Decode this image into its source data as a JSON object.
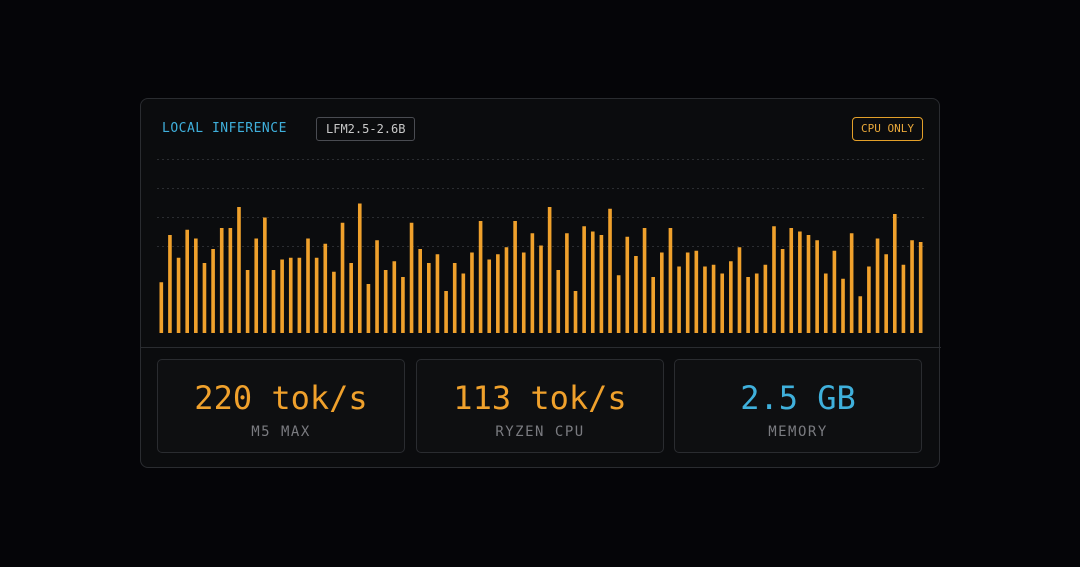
{
  "header": {
    "title": "LOCAL INFERENCE",
    "model": "LFM2.5-2.6B",
    "badge": "CPU ONLY"
  },
  "colors": {
    "bar": "#f0a12c",
    "accent_blue": "#3fb0dc",
    "accent_orange": "#e9a83a"
  },
  "chart_data": {
    "type": "bar",
    "ylim": [
      0,
      100
    ],
    "grid": true,
    "values": [
      29,
      56,
      43,
      59,
      54,
      40,
      48,
      60,
      60,
      72,
      36,
      54,
      66,
      36,
      42,
      43,
      43,
      54,
      43,
      51,
      35,
      63,
      40,
      74,
      28,
      53,
      36,
      41,
      32,
      63,
      48,
      40,
      45,
      24,
      40,
      34,
      46,
      64,
      42,
      45,
      49,
      64,
      46,
      57,
      50,
      72,
      36,
      57,
      24,
      61,
      58,
      56,
      71,
      33,
      55,
      44,
      60,
      32,
      46,
      60,
      38,
      46,
      47,
      38,
      39,
      34,
      41,
      49,
      32,
      34,
      39,
      61,
      48,
      60,
      58,
      56,
      53,
      34,
      47,
      31,
      57,
      21,
      38,
      54,
      45,
      68,
      39,
      53,
      52
    ]
  },
  "stats": [
    {
      "value": "220 tok/s",
      "label": "M5 MAX",
      "color": "#f0a12c"
    },
    {
      "value": "113 tok/s",
      "label": "RYZEN CPU",
      "color": "#f0a12c"
    },
    {
      "value": "2.5 GB",
      "label": "MEMORY",
      "color": "#3fb0dc"
    }
  ]
}
